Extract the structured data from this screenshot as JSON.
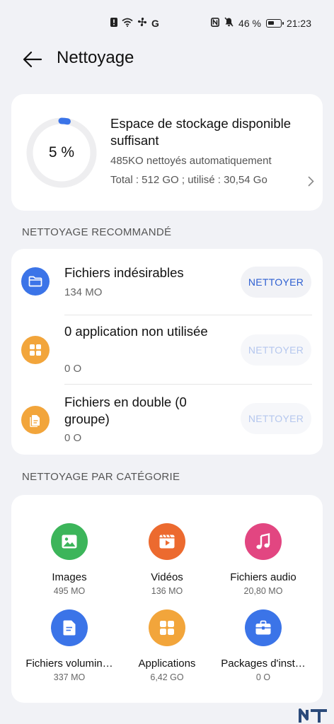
{
  "status_bar": {
    "network": "G",
    "battery_percent": "46 %",
    "time": "21:23"
  },
  "header": {
    "title": "Nettoyage"
  },
  "storage": {
    "percent_label": "5 %",
    "percent_value": 5,
    "title": "Espace de stockage disponible suffisant",
    "auto_cleaned": "485KO nettoyés automatiquement",
    "total_used": "Total : 512 GO ; utilisé : 30,54 Go"
  },
  "recommended": {
    "section_title": "NETTOYAGE RECOMMANDÉ",
    "items": [
      {
        "title": "Fichiers indésirables",
        "size": "134 MO",
        "button": "NETTOYER",
        "enabled": true,
        "color": "#3b74e8",
        "icon": "folder-icon"
      },
      {
        "title": "0 application non utilisée",
        "size": "0 O",
        "button": "NETTOYER",
        "enabled": false,
        "color": "#f2a53b",
        "icon": "apps-icon"
      },
      {
        "title": "Fichiers en double (0 groupe)",
        "size": "0 O",
        "button": "NETTOYER",
        "enabled": false,
        "color": "#f2a53b",
        "icon": "duplicate-file-icon"
      }
    ]
  },
  "categories": {
    "section_title": "NETTOYAGE PAR CATÉGORIE",
    "items": [
      {
        "name": "Images",
        "size": "495 MO",
        "color": "#3cb55a",
        "icon": "image-icon"
      },
      {
        "name": "Vidéos",
        "size": "136 MO",
        "color": "#ec6a2f",
        "icon": "video-icon"
      },
      {
        "name": "Fichiers audio",
        "size": "20,80 MO",
        "color": "#e24681",
        "icon": "music-icon"
      },
      {
        "name": "Fichiers volumin…",
        "size": "337 MO",
        "color": "#3b74e8",
        "icon": "large-file-icon"
      },
      {
        "name": "Applications",
        "size": "6,42 GO",
        "color": "#f2a53b",
        "icon": "apps-icon"
      },
      {
        "name": "Packages d'inst…",
        "size": "0 O",
        "color": "#3b74e8",
        "icon": "package-icon"
      }
    ]
  },
  "watermark": "NT"
}
